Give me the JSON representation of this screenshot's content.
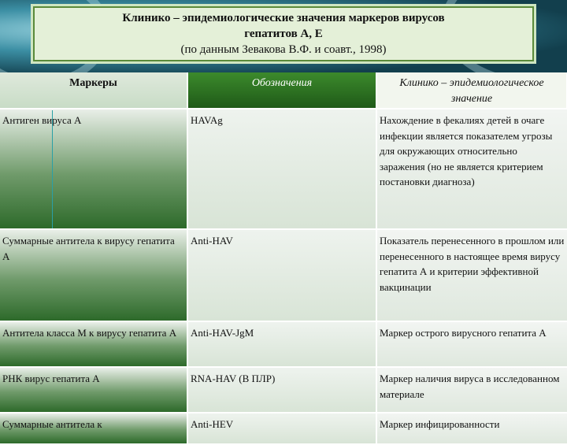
{
  "title": {
    "line1": "Клинико – эпидемиологические значения маркеров вирусов",
    "line2": "гепатитов А, Е",
    "line3": "(по данным Зевакова В.Ф. и соавт., 1998)"
  },
  "table": {
    "headers": [
      "Маркеры",
      "Обозначения",
      "Клинико – эпидемиологическое значение"
    ],
    "rows": [
      {
        "marker": "Антиген вируса А",
        "code": "HAVAg",
        "meaning": "Нахождение в фекалиях детей в очаге инфекции является показателем угрозы для окружающих относительно заражения (но не является критерием постановки диагноза)"
      },
      {
        "marker": "Суммарные антитела к вирусу гепатита А",
        "code": "Anti-HAV",
        "meaning": "Показатель перенесенного в прошлом или перенесенного в настоящее время вирусу гепатита А и критерии эффективной вакцинации"
      },
      {
        "marker": "Антитела класса М к вирусу гепатита А",
        "code": "Anti-HAV-JgM",
        "meaning": "Маркер острого вирусного гепатита А"
      },
      {
        "marker": "РНК вирус гепатита А",
        "code": "RNA-HAV (В ПЛР)",
        "meaning": "Маркер наличия вируса в исследованном материале"
      },
      {
        "marker": "Суммарные антитела к",
        "code": "Anti-HEV",
        "meaning": "Маркер инфицированности"
      }
    ]
  }
}
